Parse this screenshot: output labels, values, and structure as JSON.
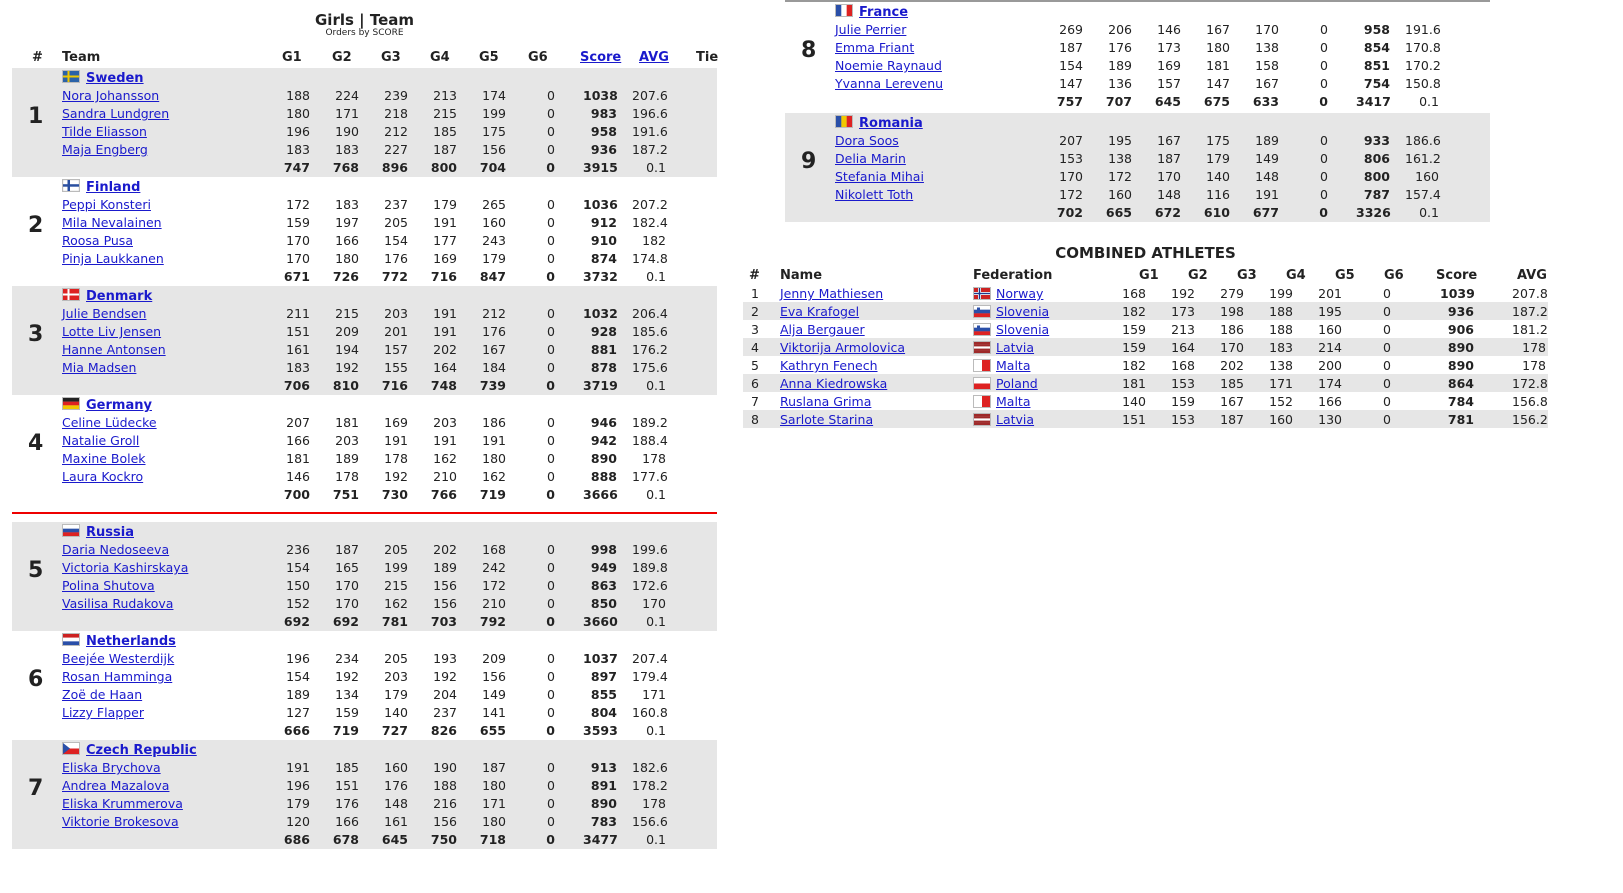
{
  "header": {
    "title": "Girls | Team",
    "subtitle": "Orders by SCORE"
  },
  "columns": {
    "rank": "#",
    "team": "Team",
    "g1": "G1",
    "g2": "G2",
    "g3": "G3",
    "g4": "G4",
    "g5": "G5",
    "g6": "G6",
    "score": "Score",
    "avg": "AVG",
    "tie": "Tie"
  },
  "teams": [
    {
      "rank": "1",
      "name": "Sweden",
      "flag": "sweden",
      "players": [
        {
          "name": "Nora Johansson",
          "g": [
            "188",
            "224",
            "239",
            "213",
            "174",
            "0"
          ],
          "score": "1038",
          "avg": "207.6"
        },
        {
          "name": "Sandra Lundgren",
          "g": [
            "180",
            "171",
            "218",
            "215",
            "199",
            "0"
          ],
          "score": "983",
          "avg": "196.6"
        },
        {
          "name": "Tilde Eliasson",
          "g": [
            "196",
            "190",
            "212",
            "185",
            "175",
            "0"
          ],
          "score": "958",
          "avg": "191.6"
        },
        {
          "name": "Maja Engberg",
          "g": [
            "183",
            "183",
            "227",
            "187",
            "156",
            "0"
          ],
          "score": "936",
          "avg": "187.2"
        }
      ],
      "totals": {
        "g": [
          "747",
          "768",
          "896",
          "800",
          "704",
          "0"
        ],
        "score": "3915",
        "avg": "0.1"
      }
    },
    {
      "rank": "2",
      "name": "Finland",
      "flag": "finland",
      "players": [
        {
          "name": "Peppi Konsteri",
          "g": [
            "172",
            "183",
            "237",
            "179",
            "265",
            "0"
          ],
          "score": "1036",
          "avg": "207.2"
        },
        {
          "name": "Mila Nevalainen",
          "g": [
            "159",
            "197",
            "205",
            "191",
            "160",
            "0"
          ],
          "score": "912",
          "avg": "182.4"
        },
        {
          "name": "Roosa Pusa",
          "g": [
            "170",
            "166",
            "154",
            "177",
            "243",
            "0"
          ],
          "score": "910",
          "avg": "182"
        },
        {
          "name": "Pinja Laukkanen",
          "g": [
            "170",
            "180",
            "176",
            "169",
            "179",
            "0"
          ],
          "score": "874",
          "avg": "174.8"
        }
      ],
      "totals": {
        "g": [
          "671",
          "726",
          "772",
          "716",
          "847",
          "0"
        ],
        "score": "3732",
        "avg": "0.1"
      }
    },
    {
      "rank": "3",
      "name": "Denmark",
      "flag": "denmark",
      "players": [
        {
          "name": "Julie Bendsen",
          "g": [
            "211",
            "215",
            "203",
            "191",
            "212",
            "0"
          ],
          "score": "1032",
          "avg": "206.4"
        },
        {
          "name": "Lotte Liv Jensen",
          "g": [
            "151",
            "209",
            "201",
            "191",
            "176",
            "0"
          ],
          "score": "928",
          "avg": "185.6"
        },
        {
          "name": "Hanne Antonsen",
          "g": [
            "161",
            "194",
            "157",
            "202",
            "167",
            "0"
          ],
          "score": "881",
          "avg": "176.2"
        },
        {
          "name": "Mia Madsen",
          "g": [
            "183",
            "192",
            "155",
            "164",
            "184",
            "0"
          ],
          "score": "878",
          "avg": "175.6"
        }
      ],
      "totals": {
        "g": [
          "706",
          "810",
          "716",
          "748",
          "739",
          "0"
        ],
        "score": "3719",
        "avg": "0.1"
      }
    },
    {
      "rank": "4",
      "name": "Germany",
      "flag": "germany",
      "players": [
        {
          "name": "Celine Lüdecke",
          "g": [
            "207",
            "181",
            "169",
            "203",
            "186",
            "0"
          ],
          "score": "946",
          "avg": "189.2"
        },
        {
          "name": "Natalie Groll",
          "g": [
            "166",
            "203",
            "191",
            "191",
            "191",
            "0"
          ],
          "score": "942",
          "avg": "188.4"
        },
        {
          "name": "Maxine Bolek",
          "g": [
            "181",
            "189",
            "178",
            "162",
            "180",
            "0"
          ],
          "score": "890",
          "avg": "178"
        },
        {
          "name": "Laura Kockro",
          "g": [
            "146",
            "178",
            "192",
            "210",
            "162",
            "0"
          ],
          "score": "888",
          "avg": "177.6"
        }
      ],
      "totals": {
        "g": [
          "700",
          "751",
          "730",
          "766",
          "719",
          "0"
        ],
        "score": "3666",
        "avg": "0.1"
      }
    },
    {
      "rank": "5",
      "name": "Russia",
      "flag": "russia",
      "players": [
        {
          "name": "Daria Nedoseeva",
          "g": [
            "236",
            "187",
            "205",
            "202",
            "168",
            "0"
          ],
          "score": "998",
          "avg": "199.6"
        },
        {
          "name": "Victoria Kashirskaya",
          "g": [
            "154",
            "165",
            "199",
            "189",
            "242",
            "0"
          ],
          "score": "949",
          "avg": "189.8"
        },
        {
          "name": "Polina Shutova",
          "g": [
            "150",
            "170",
            "215",
            "156",
            "172",
            "0"
          ],
          "score": "863",
          "avg": "172.6"
        },
        {
          "name": "Vasilisa Rudakova",
          "g": [
            "152",
            "170",
            "162",
            "156",
            "210",
            "0"
          ],
          "score": "850",
          "avg": "170"
        }
      ],
      "totals": {
        "g": [
          "692",
          "692",
          "781",
          "703",
          "792",
          "0"
        ],
        "score": "3660",
        "avg": "0.1"
      }
    },
    {
      "rank": "6",
      "name": "Netherlands",
      "flag": "netherlands",
      "players": [
        {
          "name": "Beejée Westerdijk",
          "g": [
            "196",
            "234",
            "205",
            "193",
            "209",
            "0"
          ],
          "score": "1037",
          "avg": "207.4"
        },
        {
          "name": "Rosan Hamminga",
          "g": [
            "154",
            "192",
            "203",
            "192",
            "156",
            "0"
          ],
          "score": "897",
          "avg": "179.4"
        },
        {
          "name": "Zoë de Haan",
          "g": [
            "189",
            "134",
            "179",
            "204",
            "149",
            "0"
          ],
          "score": "855",
          "avg": "171"
        },
        {
          "name": "Lizzy Flapper",
          "g": [
            "127",
            "159",
            "140",
            "237",
            "141",
            "0"
          ],
          "score": "804",
          "avg": "160.8"
        }
      ],
      "totals": {
        "g": [
          "666",
          "719",
          "727",
          "826",
          "655",
          "0"
        ],
        "score": "3593",
        "avg": "0.1"
      }
    },
    {
      "rank": "7",
      "name": "Czech Republic",
      "flag": "czech",
      "players": [
        {
          "name": "Eliska Brychova",
          "g": [
            "191",
            "185",
            "160",
            "190",
            "187",
            "0"
          ],
          "score": "913",
          "avg": "182.6"
        },
        {
          "name": "Andrea Mazalova",
          "g": [
            "196",
            "151",
            "176",
            "188",
            "180",
            "0"
          ],
          "score": "891",
          "avg": "178.2"
        },
        {
          "name": "Eliska Krummerova",
          "g": [
            "179",
            "176",
            "148",
            "216",
            "171",
            "0"
          ],
          "score": "890",
          "avg": "178"
        },
        {
          "name": "Viktorie Brokesova",
          "g": [
            "120",
            "166",
            "161",
            "156",
            "180",
            "0"
          ],
          "score": "783",
          "avg": "156.6"
        }
      ],
      "totals": {
        "g": [
          "686",
          "678",
          "645",
          "750",
          "718",
          "0"
        ],
        "score": "3477",
        "avg": "0.1"
      }
    },
    {
      "rank": "8",
      "name": "France",
      "flag": "france",
      "players": [
        {
          "name": "Julie Perrier",
          "g": [
            "269",
            "206",
            "146",
            "167",
            "170",
            "0"
          ],
          "score": "958",
          "avg": "191.6"
        },
        {
          "name": "Emma Friant",
          "g": [
            "187",
            "176",
            "173",
            "180",
            "138",
            "0"
          ],
          "score": "854",
          "avg": "170.8"
        },
        {
          "name": "Noemie Raynaud",
          "g": [
            "154",
            "189",
            "169",
            "181",
            "158",
            "0"
          ],
          "score": "851",
          "avg": "170.2"
        },
        {
          "name": "Yvanna Lerevenu",
          "g": [
            "147",
            "136",
            "157",
            "147",
            "167",
            "0"
          ],
          "score": "754",
          "avg": "150.8"
        }
      ],
      "totals": {
        "g": [
          "757",
          "707",
          "645",
          "675",
          "633",
          "0"
        ],
        "score": "3417",
        "avg": "0.1"
      }
    },
    {
      "rank": "9",
      "name": "Romania",
      "flag": "romania",
      "players": [
        {
          "name": "Dora Soos",
          "g": [
            "207",
            "195",
            "167",
            "175",
            "189",
            "0"
          ],
          "score": "933",
          "avg": "186.6"
        },
        {
          "name": "Delia Marin",
          "g": [
            "153",
            "138",
            "187",
            "179",
            "149",
            "0"
          ],
          "score": "806",
          "avg": "161.2"
        },
        {
          "name": "Stefania Mihai",
          "g": [
            "170",
            "172",
            "170",
            "140",
            "148",
            "0"
          ],
          "score": "800",
          "avg": "160"
        },
        {
          "name": "Nikolett Toth",
          "g": [
            "172",
            "160",
            "148",
            "116",
            "191",
            "0"
          ],
          "score": "787",
          "avg": "157.4"
        }
      ],
      "totals": {
        "g": [
          "702",
          "665",
          "672",
          "610",
          "677",
          "0"
        ],
        "score": "3326",
        "avg": "0.1"
      }
    }
  ],
  "combined": {
    "title": "COMBINED ATHLETES",
    "columns": {
      "rank": "#",
      "name": "Name",
      "federation": "Federation",
      "g1": "G1",
      "g2": "G2",
      "g3": "G3",
      "g4": "G4",
      "g5": "G5",
      "g6": "G6",
      "score": "Score",
      "avg": "AVG"
    },
    "rows": [
      {
        "rank": "1",
        "name": "Jenny Mathiesen",
        "federation": "Norway",
        "flag": "norway",
        "g": [
          "168",
          "192",
          "279",
          "199",
          "201",
          "0"
        ],
        "score": "1039",
        "avg": "207.8"
      },
      {
        "rank": "2",
        "name": "Eva Krafogel",
        "federation": "Slovenia",
        "flag": "slovenia",
        "g": [
          "182",
          "173",
          "198",
          "188",
          "195",
          "0"
        ],
        "score": "936",
        "avg": "187.2"
      },
      {
        "rank": "3",
        "name": "Alja Bergauer",
        "federation": "Slovenia",
        "flag": "slovenia",
        "g": [
          "159",
          "213",
          "186",
          "188",
          "160",
          "0"
        ],
        "score": "906",
        "avg": "181.2"
      },
      {
        "rank": "4",
        "name": "Viktorija Armolovica",
        "federation": "Latvia",
        "flag": "latvia",
        "g": [
          "159",
          "164",
          "170",
          "183",
          "214",
          "0"
        ],
        "score": "890",
        "avg": "178"
      },
      {
        "rank": "5",
        "name": "Kathryn Fenech",
        "federation": "Malta",
        "flag": "malta",
        "g": [
          "182",
          "168",
          "202",
          "138",
          "200",
          "0"
        ],
        "score": "890",
        "avg": "178"
      },
      {
        "rank": "6",
        "name": "Anna Kiedrowska",
        "federation": "Poland",
        "flag": "poland",
        "g": [
          "181",
          "153",
          "185",
          "171",
          "174",
          "0"
        ],
        "score": "864",
        "avg": "172.8"
      },
      {
        "rank": "7",
        "name": "Ruslana Grima",
        "federation": "Malta",
        "flag": "malta",
        "g": [
          "140",
          "159",
          "167",
          "152",
          "166",
          "0"
        ],
        "score": "784",
        "avg": "156.8"
      },
      {
        "rank": "8",
        "name": "Sarlote Starina",
        "federation": "Latvia",
        "flag": "latvia",
        "g": [
          "151",
          "153",
          "187",
          "160",
          "130",
          "0"
        ],
        "score": "781",
        "avg": "156.2"
      }
    ]
  },
  "colors": {
    "row_shade": "#e6e6e6",
    "link": "#1a1acc",
    "divider": "#ee0000"
  }
}
